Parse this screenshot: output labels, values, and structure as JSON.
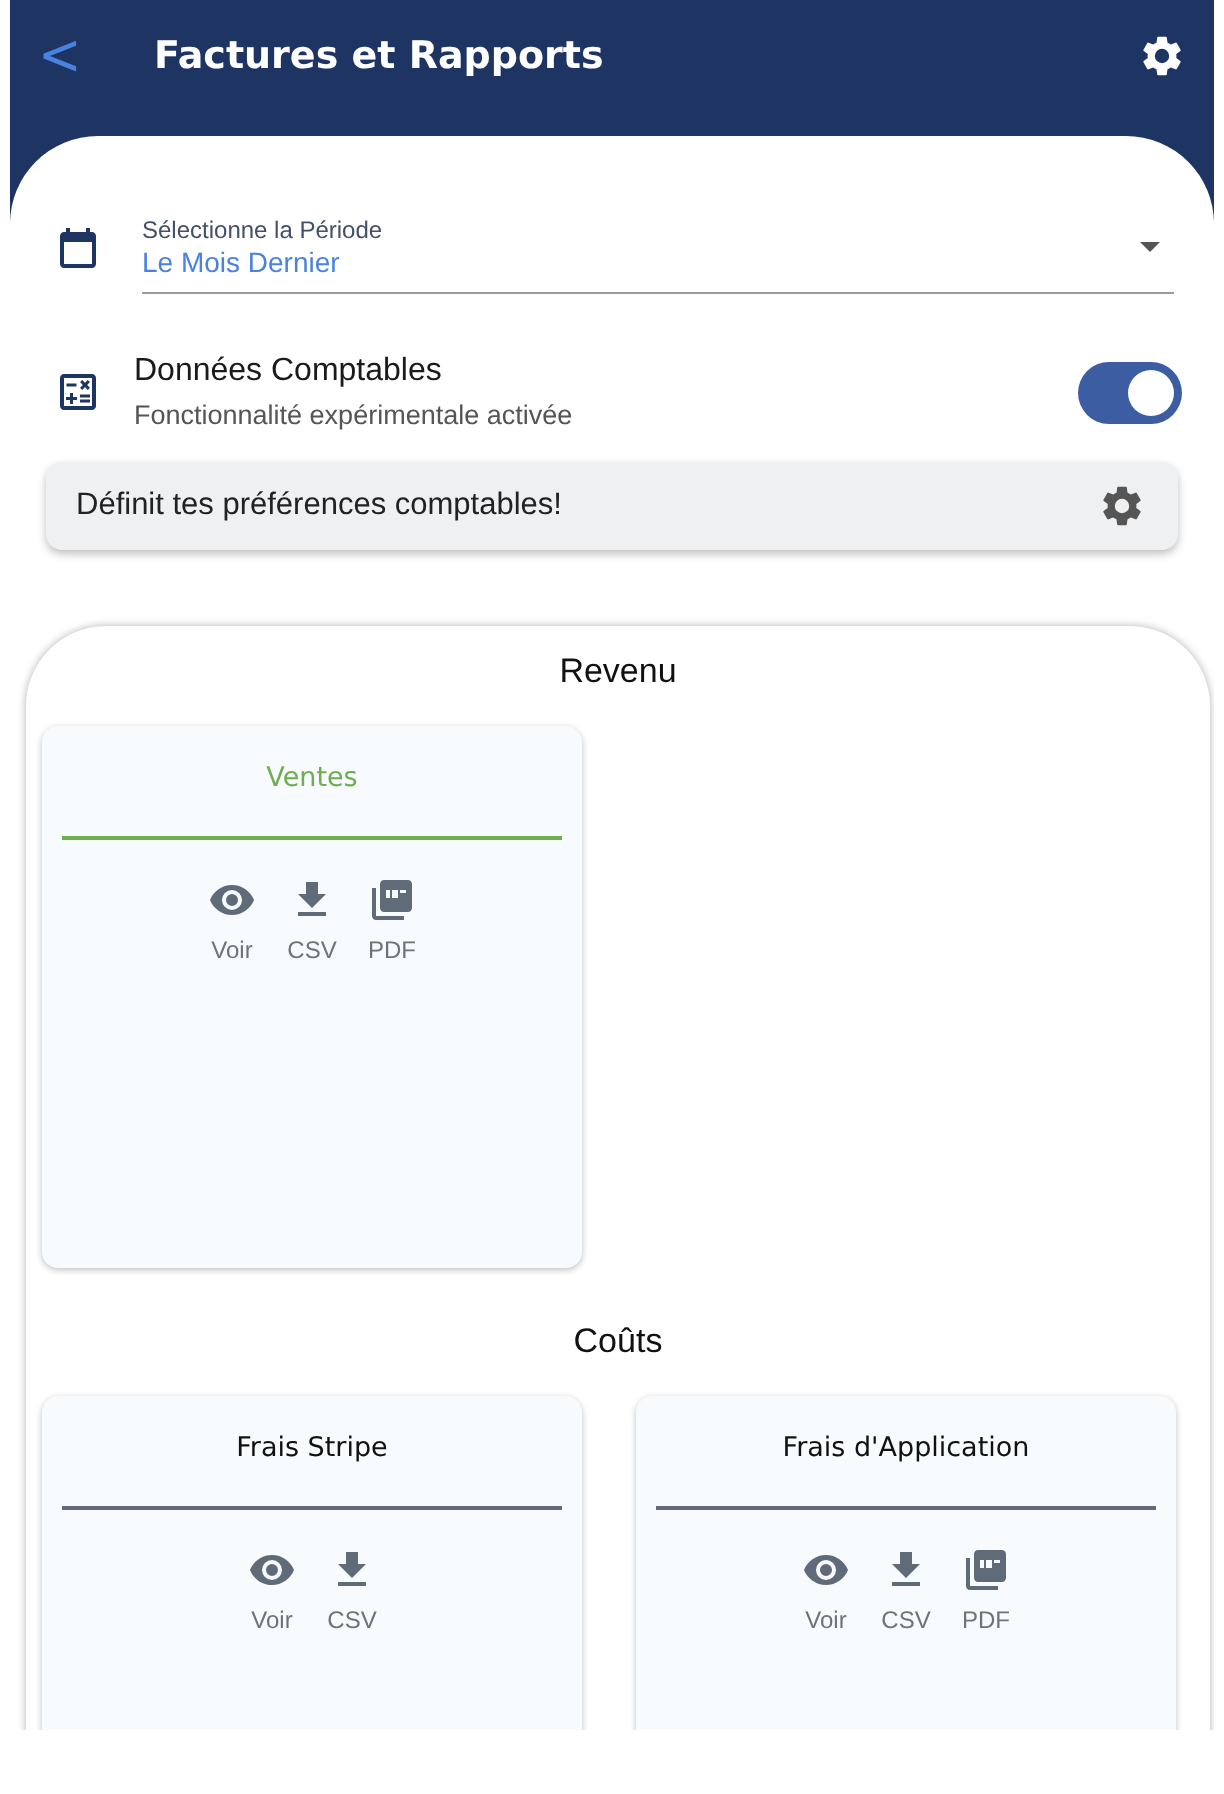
{
  "header": {
    "back_icon": "<",
    "title": "Factures et Rapports"
  },
  "period": {
    "label": "Sélectionne la Période",
    "value": "Le Mois Dernier"
  },
  "accounting": {
    "title": "Données Comptables",
    "subtitle": "Fonctionnalité expérimentale activée",
    "on": true
  },
  "preferences_button": {
    "label": "Définit tes préférences comptables!"
  },
  "sections": [
    {
      "title": "Revenu",
      "cards": [
        {
          "title": "Ventes",
          "color": "#6fae4f",
          "actions": [
            {
              "kind": "view",
              "label": "Voir"
            },
            {
              "kind": "csv",
              "label": "CSV"
            },
            {
              "kind": "pdf",
              "label": "PDF"
            }
          ]
        }
      ]
    },
    {
      "title": "Coûts",
      "cards": [
        {
          "title": "Frais Stripe",
          "color": "#5f6b78",
          "actions": [
            {
              "kind": "view",
              "label": "Voir"
            },
            {
              "kind": "csv",
              "label": "CSV"
            }
          ]
        },
        {
          "title": "Frais d'Application",
          "color": "#5f6b78",
          "actions": [
            {
              "kind": "view",
              "label": "Voir"
            },
            {
              "kind": "csv",
              "label": "CSV"
            },
            {
              "kind": "pdf",
              "label": "PDF"
            }
          ]
        }
      ]
    }
  ]
}
